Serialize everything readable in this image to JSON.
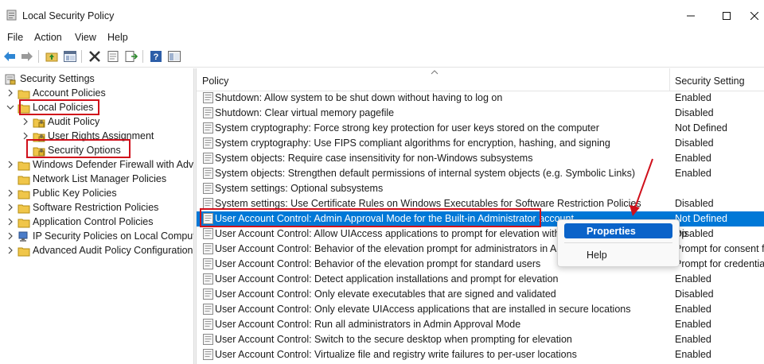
{
  "window": {
    "title": "Local Security Policy",
    "controls": [
      "minimize",
      "maximize",
      "close"
    ]
  },
  "menu": [
    "File",
    "Action",
    "View",
    "Help"
  ],
  "toolbar": {
    "buttons": [
      "back-icon",
      "forward-icon",
      "up-folder-icon",
      "show-hide-tree-icon",
      "delete-icon",
      "properties-icon",
      "export-list-icon",
      "help-icon",
      "mmc-icon"
    ]
  },
  "tree": {
    "root": "Security Settings",
    "items": [
      {
        "label": "Account Policies",
        "level": 1,
        "expanded": false
      },
      {
        "label": "Local Policies",
        "level": 1,
        "expanded": true,
        "highlighted": true
      },
      {
        "label": "Audit Policy",
        "level": 2,
        "expanded": false
      },
      {
        "label": "User Rights Assignment",
        "level": 2,
        "expanded": false
      },
      {
        "label": "Security Options",
        "level": 2,
        "selected": true,
        "highlighted": true
      },
      {
        "label": "Windows Defender Firewall with Adva",
        "level": 1,
        "expanded": false
      },
      {
        "label": "Network List Manager Policies",
        "level": 1,
        "expanded": null
      },
      {
        "label": "Public Key Policies",
        "level": 1,
        "expanded": false
      },
      {
        "label": "Software Restriction Policies",
        "level": 1,
        "expanded": false
      },
      {
        "label": "Application Control Policies",
        "level": 1,
        "expanded": false
      },
      {
        "label": "IP Security Policies on Local Compute",
        "level": 1,
        "expanded": false
      },
      {
        "label": "Advanced Audit Policy Configuration",
        "level": 1,
        "expanded": false
      }
    ]
  },
  "list": {
    "columns": [
      "Policy",
      "Security Setting"
    ],
    "rows": [
      {
        "policy": "Shutdown: Allow system to be shut down without having to log on",
        "setting": "Enabled"
      },
      {
        "policy": "Shutdown: Clear virtual memory pagefile",
        "setting": "Disabled"
      },
      {
        "policy": "System cryptography: Force strong key protection for user keys stored on the computer",
        "setting": "Not Defined"
      },
      {
        "policy": "System cryptography: Use FIPS compliant algorithms for encryption, hashing, and signing",
        "setting": "Disabled"
      },
      {
        "policy": "System objects: Require case insensitivity for non-Windows subsystems",
        "setting": "Enabled"
      },
      {
        "policy": "System objects: Strengthen default permissions of internal system objects (e.g. Symbolic Links)",
        "setting": "Enabled"
      },
      {
        "policy": "System settings: Optional subsystems",
        "setting": ""
      },
      {
        "policy": "System settings: Use Certificate Rules on Windows Executables for Software Restriction Policies",
        "setting": "Disabled"
      },
      {
        "policy": "User Account Control: Admin Approval Mode for the Built-in Administrator account",
        "setting": "Not Defined",
        "selected": true
      },
      {
        "policy": "User Account Control: Allow UIAccess applications to prompt for elevation without using the secure desktop",
        "setting": "Disabled"
      },
      {
        "policy": "User Account Control: Behavior of the elevation prompt for administrators in Admin Approval Mode",
        "setting": "Prompt for consent for"
      },
      {
        "policy": "User Account Control: Behavior of the elevation prompt for standard users",
        "setting": "Prompt for credentials"
      },
      {
        "policy": "User Account Control: Detect application installations and prompt for elevation",
        "setting": "Enabled"
      },
      {
        "policy": "User Account Control: Only elevate executables that are signed and validated",
        "setting": "Disabled"
      },
      {
        "policy": "User Account Control: Only elevate UIAccess applications that are installed in secure locations",
        "setting": "Enabled"
      },
      {
        "policy": "User Account Control: Run all administrators in Admin Approval Mode",
        "setting": "Enabled"
      },
      {
        "policy": "User Account Control: Switch to the secure desktop when prompting for elevation",
        "setting": "Enabled"
      },
      {
        "policy": "User Account Control: Virtualize file and registry write failures to per-user locations",
        "setting": "Enabled"
      }
    ]
  },
  "context_menu": {
    "items": [
      "Properties",
      "Help"
    ],
    "active": "Properties"
  },
  "colors": {
    "selection": "#0078d7",
    "annotation": "#d0101b",
    "menu_active": "#0a63c9"
  }
}
